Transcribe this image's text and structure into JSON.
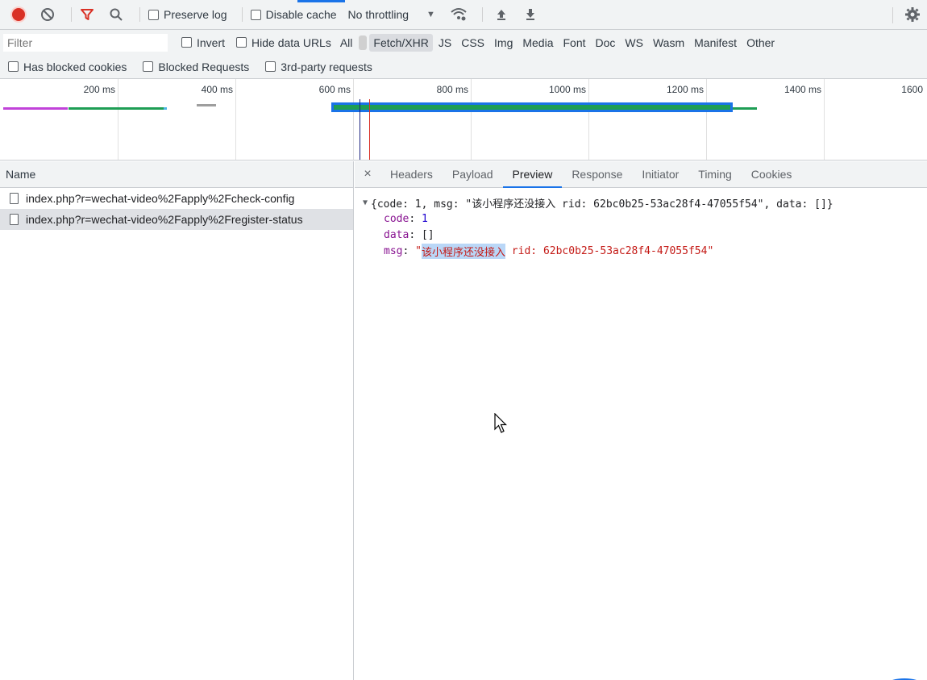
{
  "toolbar": {
    "preserve_log": "Preserve log",
    "disable_cache": "Disable cache",
    "throttling": "No throttling"
  },
  "filters": {
    "placeholder": "Filter",
    "invert": "Invert",
    "hide_data_urls": "Hide data URLs",
    "types": [
      "All",
      "Fetch/XHR",
      "JS",
      "CSS",
      "Img",
      "Media",
      "Font",
      "Doc",
      "WS",
      "Wasm",
      "Manifest",
      "Other"
    ],
    "active_type": "Fetch/XHR",
    "has_blocked_cookies": "Has blocked cookies",
    "blocked_requests": "Blocked Requests",
    "third_party": "3rd-party requests"
  },
  "overview": {
    "ticks": [
      "200 ms",
      "400 ms",
      "600 ms",
      "800 ms",
      "1000 ms",
      "1200 ms",
      "1400 ms",
      "1600"
    ]
  },
  "requests": {
    "header": "Name",
    "items": [
      {
        "name": "index.php?r=wechat-video%2Fapply%2Fcheck-config"
      },
      {
        "name": "index.php?r=wechat-video%2Fapply%2Fregister-status"
      }
    ]
  },
  "details": {
    "close": "×",
    "tabs": [
      "Headers",
      "Payload",
      "Preview",
      "Response",
      "Initiator",
      "Timing",
      "Cookies"
    ],
    "active_tab": "Preview",
    "preview": {
      "summary": "{code: 1, msg: \"该小程序还没接入 rid: 62bc0b25-53ac28f4-47055f54\", data: []}",
      "code_key": "code",
      "code_val": "1",
      "data_key": "data",
      "data_val": "[]",
      "msg_key": "msg",
      "msg_quote_open": "\"",
      "msg_highlight": "该小程序还没接入",
      "msg_rest": " rid: 62bc0b25-53ac28f4-47055f54\""
    }
  }
}
